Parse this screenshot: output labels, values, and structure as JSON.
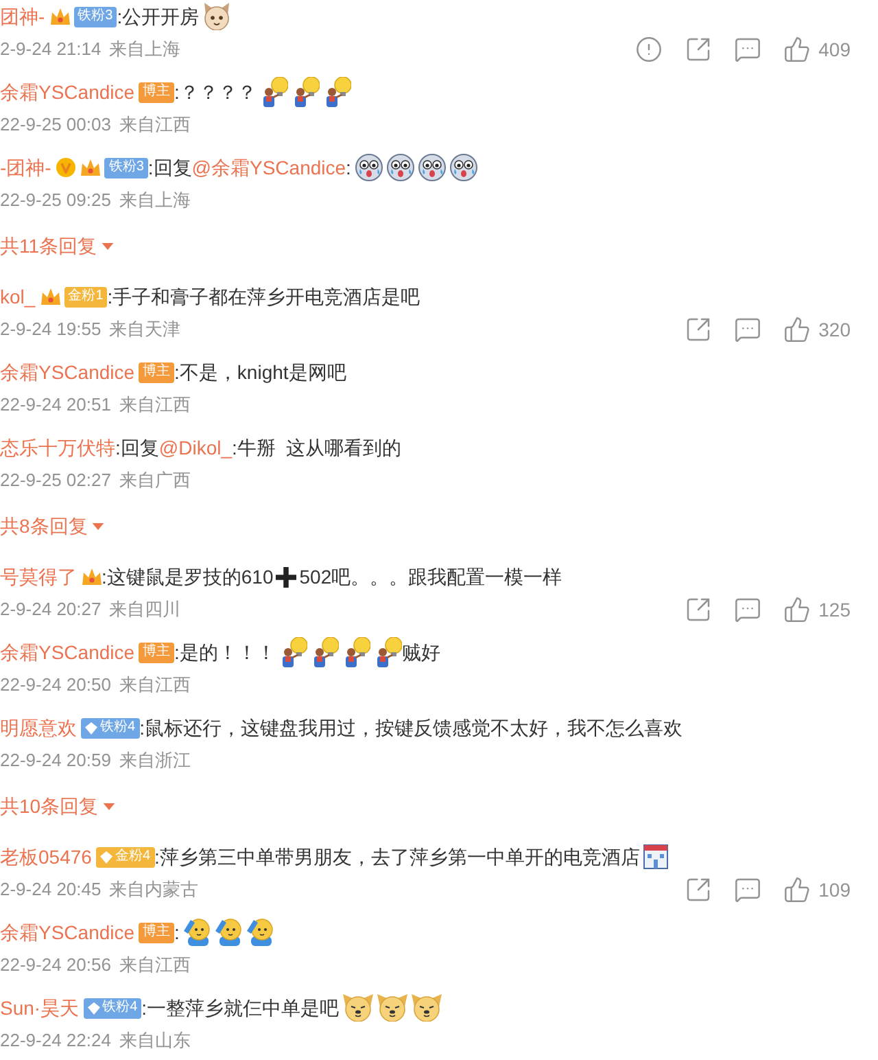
{
  "threads": [
    {
      "comment": {
        "author": "团神-",
        "verified": false,
        "badges": [
          {
            "kind": "iron_fan",
            "label": "铁粉3"
          }
        ],
        "body": [
          {
            "kind": "text",
            "text": ":公开开房"
          },
          {
            "kind": "cat"
          }
        ],
        "time": "2-9-24 21:14",
        "location": "来自上海",
        "actions": [
          {
            "kind": "report"
          },
          {
            "kind": "share"
          },
          {
            "kind": "comment"
          },
          {
            "kind": "like",
            "count": "409"
          }
        ]
      },
      "replies": [
        {
          "author": "余霜YSCandice",
          "verified": false,
          "badges": [
            {
              "kind": "host",
              "label": "博主"
            }
          ],
          "body": [
            {
              "kind": "text",
              "text": ":？？？？"
            },
            {
              "kind": "bulb"
            },
            {
              "kind": "bulb"
            },
            {
              "kind": "bulb"
            }
          ],
          "time": "22-9-25 00:03",
          "location": "来自江西"
        },
        {
          "author": "-团神-",
          "verified": true,
          "badges": [
            {
              "kind": "iron_fan",
              "label": "铁粉3"
            }
          ],
          "body": [
            {
              "kind": "text",
              "text": ":回复"
            },
            {
              "kind": "mention",
              "text": "@余霜YSCandice"
            },
            {
              "kind": "text",
              "text": ":"
            },
            {
              "kind": "crying"
            },
            {
              "kind": "crying"
            },
            {
              "kind": "crying"
            },
            {
              "kind": "crying"
            }
          ],
          "time": "22-9-25 09:25",
          "location": "来自上海"
        }
      ],
      "more": "共11条回复"
    },
    {
      "comment": {
        "author": "kol_",
        "verified": false,
        "badges": [
          {
            "kind": "gold_fan",
            "label": "金粉1"
          }
        ],
        "body": [
          {
            "kind": "text",
            "text": ":手子和膏子都在萍乡开电竞酒店是吧"
          }
        ],
        "time": "2-9-24 19:55",
        "location": "来自天津",
        "actions": [
          {
            "kind": "share"
          },
          {
            "kind": "comment"
          },
          {
            "kind": "like",
            "count": "320"
          }
        ]
      },
      "replies": [
        {
          "author": "余霜YSCandice",
          "verified": false,
          "badges": [
            {
              "kind": "host",
              "label": "博主"
            }
          ],
          "body": [
            {
              "kind": "text",
              "text": ":不是，knight是网吧"
            }
          ],
          "time": "22-9-24 20:51",
          "location": "来自江西"
        },
        {
          "author": "态乐十万伏特",
          "verified": false,
          "body": [
            {
              "kind": "text",
              "text": ":回复"
            },
            {
              "kind": "mention",
              "text": "@Dikol_"
            },
            {
              "kind": "text",
              "text": ":牛掰  这从哪看到的"
            }
          ],
          "time": "22-9-25 02:27",
          "location": "来自广西"
        }
      ],
      "more": "共8条回复"
    },
    {
      "comment": {
        "author": "号莫得了",
        "verified": false,
        "badges": [
          {
            "kind": "crown"
          }
        ],
        "body": [
          {
            "kind": "text",
            "text": ":这键鼠是罗技的610"
          },
          {
            "kind": "plus"
          },
          {
            "kind": "text",
            "text": "502吧。。。跟我配置一模一样"
          }
        ],
        "time": "2-9-24 20:27",
        "location": "来自四川",
        "actions": [
          {
            "kind": "share"
          },
          {
            "kind": "comment"
          },
          {
            "kind": "like",
            "count": "125"
          }
        ]
      },
      "replies": [
        {
          "author": "余霜YSCandice",
          "verified": false,
          "badges": [
            {
              "kind": "host",
              "label": "博主"
            }
          ],
          "body": [
            {
              "kind": "text",
              "text": ":是的！！！"
            },
            {
              "kind": "bulb"
            },
            {
              "kind": "bulb"
            },
            {
              "kind": "bulb"
            },
            {
              "kind": "bulb"
            },
            {
              "kind": "text",
              "text": "贼好"
            }
          ],
          "time": "22-9-24 20:50",
          "location": "来自江西"
        },
        {
          "author": "明愿意欢",
          "verified": false,
          "badges": [
            {
              "kind": "iron_fan_diamond",
              "label": "铁粉4"
            }
          ],
          "body": [
            {
              "kind": "text",
              "text": ":鼠标还行，这键盘我用过，按键反馈感觉不太好，我不怎么喜欢"
            }
          ],
          "time": "22-9-24 20:59",
          "location": "来自浙江"
        }
      ],
      "more": "共10条回复"
    },
    {
      "comment": {
        "author": "老板05476",
        "verified": false,
        "badges": [
          {
            "kind": "gold_fan_diamond",
            "label": "金粉4"
          }
        ],
        "body": [
          {
            "kind": "text",
            "text": ":萍乡第三中单带男朋友，去了萍乡第一中单开的电竞酒店"
          },
          {
            "kind": "hotel"
          }
        ],
        "time": "2-9-24 20:45",
        "location": "来自内蒙古",
        "actions": [
          {
            "kind": "share"
          },
          {
            "kind": "comment"
          },
          {
            "kind": "like",
            "count": "109"
          }
        ]
      },
      "replies": [
        {
          "author": "余霜YSCandice",
          "verified": false,
          "badges": [
            {
              "kind": "host",
              "label": "博主"
            }
          ],
          "body": [
            {
              "kind": "text",
              "text": ":"
            },
            {
              "kind": "salute"
            },
            {
              "kind": "salute"
            },
            {
              "kind": "salute"
            }
          ],
          "time": "22-9-24 20:56",
          "location": "来自江西"
        },
        {
          "author": "Sun·昊天",
          "verified": false,
          "badges": [
            {
              "kind": "iron_fan_diamond",
              "label": "铁粉4"
            }
          ],
          "body": [
            {
              "kind": "text",
              "text": ":一整萍乡就仨中单是吧"
            },
            {
              "kind": "doge"
            },
            {
              "kind": "doge"
            },
            {
              "kind": "doge"
            }
          ],
          "time": "22-9-24 22:24",
          "location": "来自山东"
        }
      ]
    }
  ]
}
